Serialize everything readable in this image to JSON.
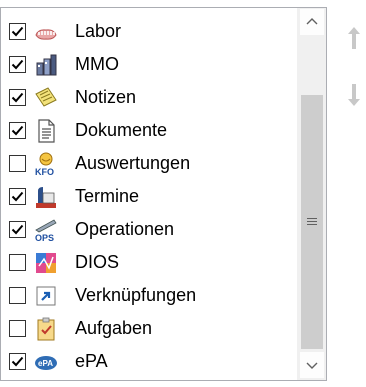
{
  "items": [
    {
      "label": "Labor",
      "checked": true,
      "icon": "dental-lab-icon"
    },
    {
      "label": "MMO",
      "checked": true,
      "icon": "mmo-icon"
    },
    {
      "label": "Notizen",
      "checked": true,
      "icon": "notes-icon"
    },
    {
      "label": "Dokumente",
      "checked": true,
      "icon": "document-icon"
    },
    {
      "label": "Auswertungen",
      "checked": false,
      "icon": "kfo-evaluation-icon"
    },
    {
      "label": "Termine",
      "checked": true,
      "icon": "appointments-icon"
    },
    {
      "label": "Operationen",
      "checked": true,
      "icon": "ops-icon"
    },
    {
      "label": "DIOS",
      "checked": false,
      "icon": "dios-icon"
    },
    {
      "label": "Verknüpfungen",
      "checked": false,
      "icon": "shortcut-icon"
    },
    {
      "label": "Aufgaben",
      "checked": false,
      "icon": "task-clipboard-icon"
    },
    {
      "label": "ePA",
      "checked": true,
      "icon": "epa-icon"
    }
  ],
  "icon_texts": {
    "kfo": "KFO",
    "ops": "OPS",
    "epa": "ePA"
  },
  "buttons": {
    "move_up": "up-arrow-icon",
    "move_down": "down-arrow-icon"
  }
}
